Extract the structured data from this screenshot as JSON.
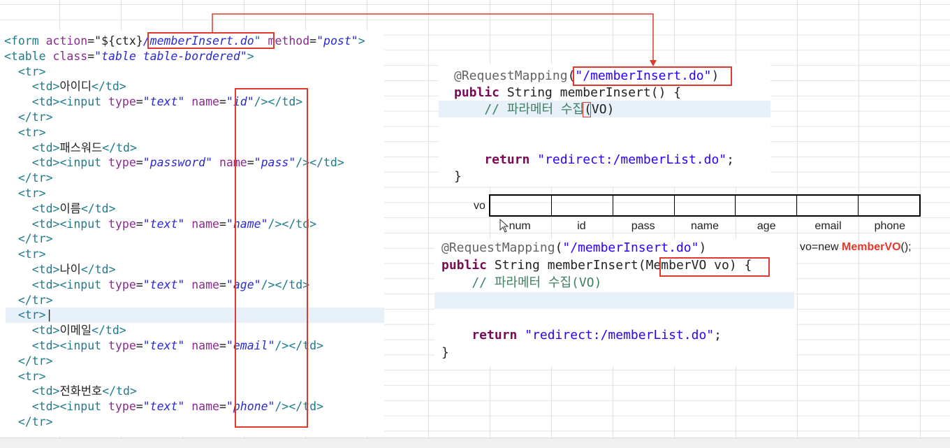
{
  "left_code": {
    "lines": [
      {
        "t": [
          [
            "tag",
            "<form "
          ],
          [
            "attr",
            "action"
          ],
          [
            "",
            "=\"${ctx}"
          ],
          [
            "str",
            "/memberInsert.do"
          ],
          [
            "tag",
            "\""
          ],
          [
            "attr",
            " method"
          ],
          [
            "",
            "="
          ],
          [
            "str",
            "\"post\""
          ],
          [
            "tag",
            ">"
          ]
        ]
      },
      {
        "t": [
          [
            "tag",
            "<table "
          ],
          [
            "attr",
            "class"
          ],
          [
            "",
            "="
          ],
          [
            "str",
            "\"table table-bordered\""
          ],
          [
            "tag",
            ">"
          ]
        ]
      },
      {
        "t": [
          [
            "tag",
            "  <tr>"
          ]
        ]
      },
      {
        "t": [
          [
            "tag",
            "    <td>"
          ],
          [
            "",
            "아이디"
          ],
          [
            "tag",
            "</td>"
          ]
        ]
      },
      {
        "t": [
          [
            "tag",
            "    <td><input "
          ],
          [
            "attr",
            "type"
          ],
          [
            "",
            "="
          ],
          [
            "str",
            "\"text\""
          ],
          [
            "attr",
            " name"
          ],
          [
            "",
            "="
          ],
          [
            "str",
            "\"id\""
          ],
          [
            "tag",
            "/></td>"
          ]
        ]
      },
      {
        "t": [
          [
            "tag",
            "  </tr>"
          ]
        ]
      },
      {
        "t": [
          [
            "tag",
            "  <tr>"
          ]
        ]
      },
      {
        "t": [
          [
            "tag",
            "    <td>"
          ],
          [
            "",
            "패스워드"
          ],
          [
            "tag",
            "</td>"
          ]
        ]
      },
      {
        "t": [
          [
            "tag",
            "    <td><input "
          ],
          [
            "attr",
            "type"
          ],
          [
            "",
            "="
          ],
          [
            "str",
            "\"password\""
          ],
          [
            "attr",
            " name"
          ],
          [
            "",
            "="
          ],
          [
            "str",
            "\"pass\""
          ],
          [
            "tag",
            "/></td>"
          ]
        ]
      },
      {
        "t": [
          [
            "tag",
            "  </tr>"
          ]
        ]
      },
      {
        "t": [
          [
            "tag",
            "  <tr>"
          ]
        ]
      },
      {
        "t": [
          [
            "tag",
            "    <td>"
          ],
          [
            "",
            "이름"
          ],
          [
            "tag",
            "</td>"
          ]
        ]
      },
      {
        "t": [
          [
            "tag",
            "    <td><input "
          ],
          [
            "attr",
            "type"
          ],
          [
            "",
            "="
          ],
          [
            "str",
            "\"text\""
          ],
          [
            "attr",
            " name"
          ],
          [
            "",
            "="
          ],
          [
            "str",
            "\"name\""
          ],
          [
            "tag",
            "/></td>"
          ]
        ]
      },
      {
        "t": [
          [
            "tag",
            "  </tr>"
          ]
        ]
      },
      {
        "t": [
          [
            "tag",
            "  <tr>"
          ]
        ]
      },
      {
        "t": [
          [
            "tag",
            "    <td>"
          ],
          [
            "",
            "나이"
          ],
          [
            "tag",
            "</td>"
          ]
        ]
      },
      {
        "t": [
          [
            "tag",
            "    <td><input "
          ],
          [
            "attr",
            "type"
          ],
          [
            "",
            "="
          ],
          [
            "str",
            "\"text\""
          ],
          [
            "attr",
            " name"
          ],
          [
            "",
            "="
          ],
          [
            "str",
            "\"age\""
          ],
          [
            "tag",
            "/></td>"
          ]
        ]
      },
      {
        "t": [
          [
            "tag",
            "  </tr>"
          ]
        ]
      },
      {
        "t": [
          [
            "tag",
            "  <tr>"
          ],
          [
            "",
            "|"
          ]
        ]
      },
      {
        "t": [
          [
            "tag",
            "    <td>"
          ],
          [
            "",
            "이메일"
          ],
          [
            "tag",
            "</td>"
          ]
        ]
      },
      {
        "t": [
          [
            "tag",
            "    <td><input "
          ],
          [
            "attr",
            "type"
          ],
          [
            "",
            "="
          ],
          [
            "str",
            "\"text\""
          ],
          [
            "attr",
            " name"
          ],
          [
            "",
            "="
          ],
          [
            "str",
            "\"email\""
          ],
          [
            "tag",
            "/></td>"
          ]
        ]
      },
      {
        "t": [
          [
            "tag",
            "  </tr>"
          ]
        ]
      },
      {
        "t": [
          [
            "tag",
            "  <tr>"
          ]
        ]
      },
      {
        "t": [
          [
            "tag",
            "    <td>"
          ],
          [
            "",
            "전화번호"
          ],
          [
            "tag",
            "</td>"
          ]
        ]
      },
      {
        "t": [
          [
            "tag",
            "    <td><input "
          ],
          [
            "attr",
            "type"
          ],
          [
            "",
            "="
          ],
          [
            "str",
            "\"text\""
          ],
          [
            "attr",
            " name"
          ],
          [
            "",
            "="
          ],
          [
            "str",
            "\"phone\""
          ],
          [
            "tag",
            "/></td>"
          ]
        ]
      },
      {
        "t": [
          [
            "tag",
            "  </tr>"
          ]
        ]
      }
    ]
  },
  "right_top_code": {
    "lines": [
      {
        "t": [
          [
            "ann",
            "@RequestMapping"
          ],
          [
            "",
            "("
          ],
          [
            "rstr",
            "\"/memberInsert.do\""
          ],
          [
            "",
            ")"
          ]
        ]
      },
      {
        "t": [
          [
            "kw",
            "public"
          ],
          [
            "",
            " String memberInsert() {"
          ]
        ]
      },
      {
        "t": [
          [
            "cm",
            "    // 파라메터 수집"
          ],
          [
            "",
            "(VO)"
          ]
        ]
      },
      {
        "t": [
          [
            "",
            ""
          ]
        ]
      },
      {
        "t": [
          [
            "",
            ""
          ]
        ]
      },
      {
        "t": [
          [
            "kw",
            "    return"
          ],
          [
            "rstr",
            " \"redirect:/memberList.do\""
          ],
          [
            "",
            ";"
          ]
        ]
      },
      {
        "t": [
          [
            "",
            "}"
          ]
        ]
      }
    ]
  },
  "right_bottom_code": {
    "lines": [
      {
        "t": [
          [
            "ann",
            "@RequestMapping"
          ],
          [
            "",
            "("
          ],
          [
            "rstr",
            "\"/memberInsert.do\""
          ],
          [
            "",
            ")"
          ]
        ]
      },
      {
        "t": [
          [
            "kw",
            "public"
          ],
          [
            "",
            " String memberInsert(MemberVO vo) {"
          ]
        ]
      },
      {
        "t": [
          [
            "cm",
            "    // 파라메터 수집(VO)"
          ]
        ]
      },
      {
        "t": [
          [
            "",
            ""
          ]
        ]
      },
      {
        "t": [
          [
            "",
            ""
          ]
        ]
      },
      {
        "t": [
          [
            "kw",
            "    return"
          ],
          [
            "rstr",
            " \"redirect:/memberList.do\""
          ],
          [
            "",
            ";"
          ]
        ]
      },
      {
        "t": [
          [
            "",
            "}"
          ]
        ]
      }
    ]
  },
  "vo_diagram": {
    "label": "vo",
    "fields": [
      "num",
      "id",
      "pass",
      "name",
      "age",
      "email",
      "phone"
    ]
  },
  "vo_new": {
    "prefix": "vo=new ",
    "class_name": "MemberVO",
    "suffix": "();"
  },
  "colors": {
    "annotation_red": "#e03a2e",
    "tag": "#1e7a8c",
    "attribute": "#8a2a8e",
    "string": "#2a2ad0",
    "keyword": "#7b0a55"
  }
}
